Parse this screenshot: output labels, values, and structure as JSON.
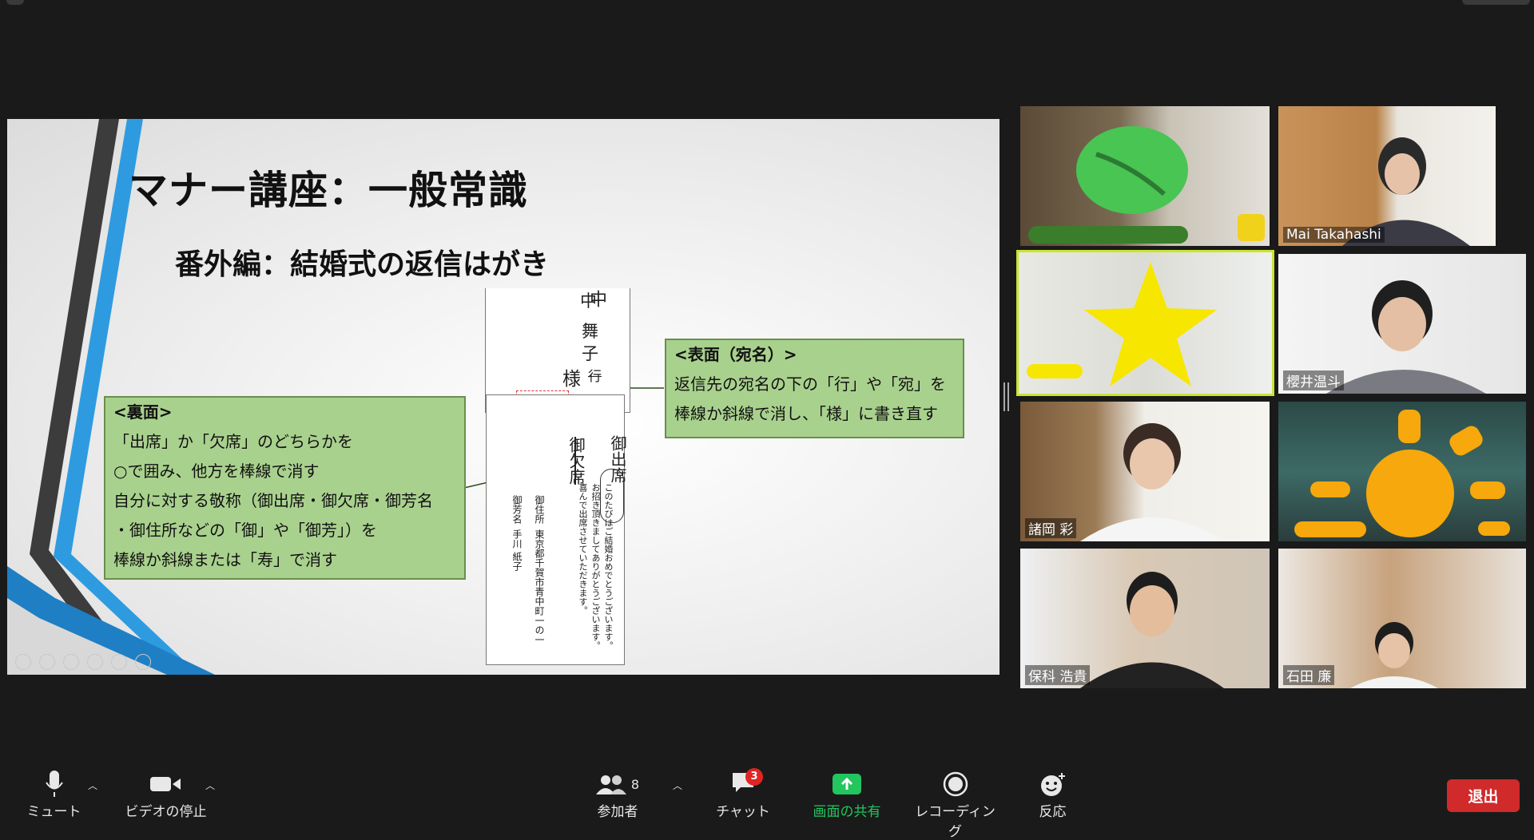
{
  "slide": {
    "title": "マナー講座：一般常識",
    "subtitle": "番外編：結婚式の返信はがき",
    "back_callout": {
      "heading": "<裏面>",
      "lines": [
        "「出席」か「欠席」のどちらかを",
        "○で囲み、他方を棒線で消す",
        "自分に対する敬称（御出席・御欠席・御芳名",
        "・御住所などの「御」や「御芳」）を",
        "棒線か斜線または「寿」で消す"
      ]
    },
    "front_callout": {
      "heading": "<表面（宛名）>",
      "lines": [
        "返信先の宛名の下の「行」や「宛」を",
        "棒線か斜線で消し、「様」に書き直す"
      ]
    },
    "postcard": {
      "addressee": [
        "中",
        "舞",
        "子",
        "様"
      ],
      "crossed": "行",
      "attend": "御出席",
      "absent": "御欠席",
      "message": "このたびはご結婚おめでとうございます。お招き頂きましてありがとうございます。喜んで出席させていただきます。",
      "address_label": "御住所",
      "address": "東京都千賀市青中町一の一",
      "name_label": "御芳名",
      "name": "手川 紙子"
    }
  },
  "participants": [
    {
      "name": ""
    },
    {
      "name": "Mai Takahashi"
    },
    {
      "name": ""
    },
    {
      "name": "櫻井温斗"
    },
    {
      "name": "諸岡 彩"
    },
    {
      "name": ""
    },
    {
      "name": "保科 浩貴"
    },
    {
      "name": "石田 廉"
    }
  ],
  "toolbar": {
    "mute": "ミュート",
    "video": "ビデオの停止",
    "participants": "参加者",
    "participant_count": "8",
    "chat": "チャット",
    "chat_badge": "3",
    "share": "画面の共有",
    "record": "レコーディング",
    "reactions": "反応",
    "leave": "退出"
  },
  "colors": {
    "share_green": "#22c55e",
    "leave_red": "#d02a2a",
    "active_speaker": "#c9e531",
    "callout_fill": "#a9d18e"
  }
}
